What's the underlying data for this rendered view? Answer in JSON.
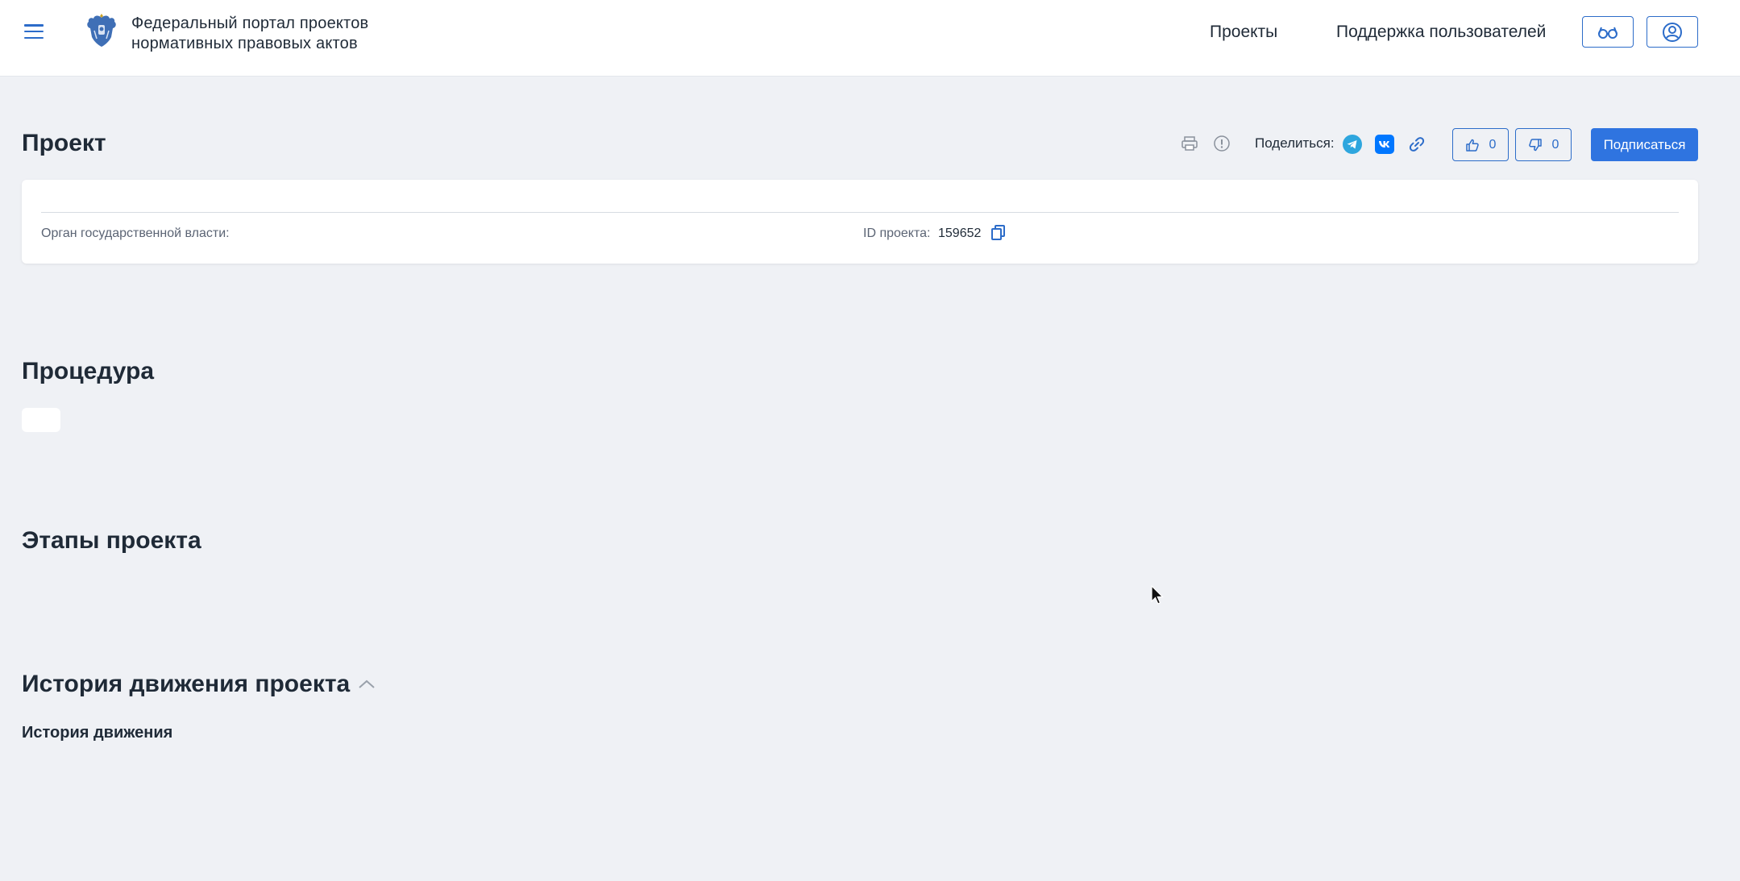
{
  "header": {
    "portal_title_line1": "Федеральный портал проектов",
    "portal_title_line2": "нормативных правовых актов",
    "nav": {
      "projects": "Проекты",
      "support": "Поддержка пользователей"
    },
    "icons": {
      "menu": "hamburger-menu-icon",
      "logo": "coat-of-arms-logo",
      "accessibility": "glasses-icon",
      "account": "user-circle-icon"
    }
  },
  "project": {
    "title": "Проект",
    "share_label": "Поделиться:",
    "share_icons": [
      "telegram-icon",
      "vk-icon",
      "link-icon"
    ],
    "toolbar_icons": [
      "print-icon",
      "report-icon"
    ],
    "likes": "0",
    "dislikes": "0",
    "subscribe_label": "Подписаться",
    "authority_label": "Орган государственной власти:",
    "id_label": "ID проекта:",
    "id_value": "159652"
  },
  "sections": {
    "procedure": "Процедура",
    "stages": "Этапы проекта",
    "history": "История движения проекта",
    "history_sub": "История движения"
  },
  "colors": {
    "accent": "#2c6cc9",
    "subscribe_bg": "#2f74e0",
    "page_bg": "#eff1f5",
    "telegram": "#2ea6de",
    "vk": "#0077ff"
  }
}
